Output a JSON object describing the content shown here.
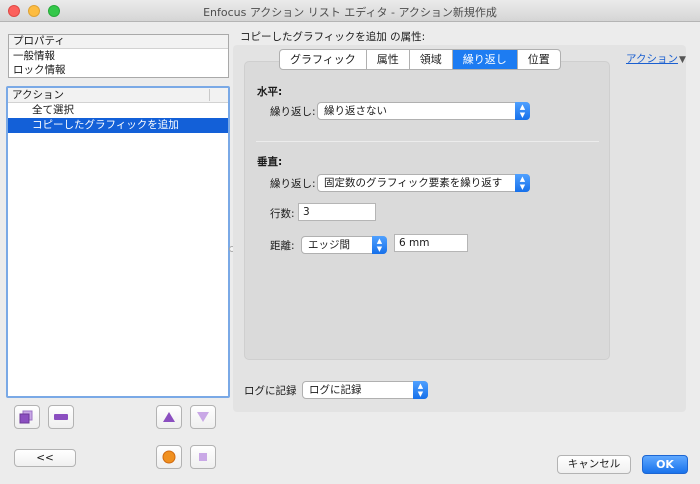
{
  "window": {
    "title": "Enfocus アクション リスト エディタ - アクション新規作成"
  },
  "properties_panel": {
    "header": "プロパティ",
    "items": [
      "一般情報",
      "ロック情報"
    ]
  },
  "action_panel": {
    "header": "アクション",
    "items": [
      {
        "label": "全て選択",
        "selected": false
      },
      {
        "label": "コピーしたグラフィックを追加",
        "selected": true
      }
    ]
  },
  "list_buttons": {
    "collapse_label": "<<"
  },
  "attributes": {
    "title": "コピーしたグラフィックを追加 の属性:",
    "tabs": [
      "グラフィック",
      "属性",
      "領域",
      "繰り返し",
      "位置"
    ],
    "active_tab": "繰り返し",
    "action_link": "アクション",
    "horizontal": {
      "section_label": "水平:",
      "repeat_label": "繰り返し:",
      "repeat_value": "繰り返さない"
    },
    "vertical": {
      "section_label": "垂直:",
      "repeat_label": "繰り返し:",
      "repeat_value": "固定数のグラフィック要素を繰り返す",
      "rows_label": "行数:",
      "rows_value": "3",
      "distance_label": "距離:",
      "distance_mode": "エッジ間",
      "distance_value": "6 mm"
    }
  },
  "log": {
    "label": "ログに記録",
    "value": "ログに記録"
  },
  "footer": {
    "cancel_label": "キャンセル",
    "ok_label": "OK"
  },
  "colors": {
    "accent": "#1d7cf2",
    "selection": "#1360d8",
    "close": "#fc605c",
    "minimize": "#fdbc40",
    "maximize": "#34c84a"
  }
}
